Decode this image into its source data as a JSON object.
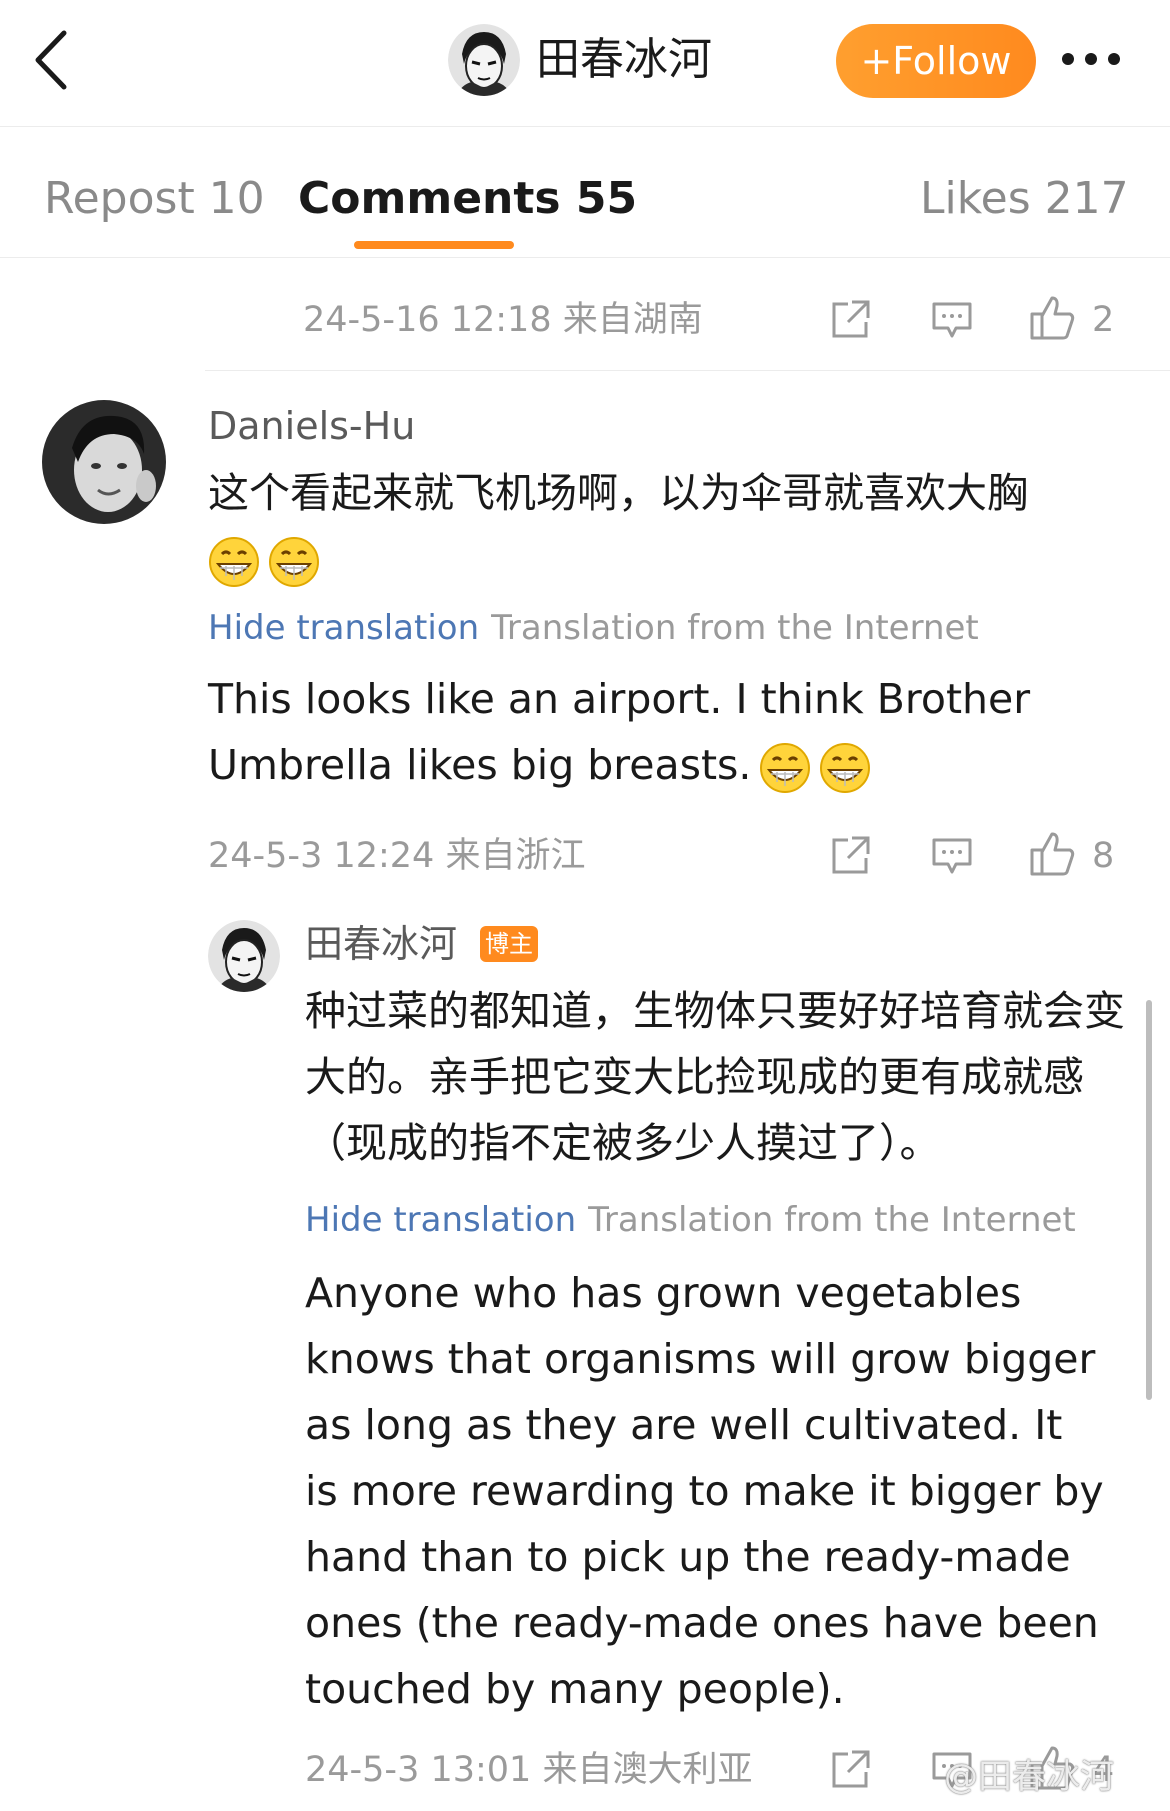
{
  "header": {
    "title": "田春冰河",
    "follow_label": "+Follow"
  },
  "tabs": {
    "repost": "Repost 10",
    "comments": "Comments 55",
    "likes": "Likes 217"
  },
  "prev_comment": {
    "meta": "24-5-16 12:18  来自湖南",
    "likes": "2"
  },
  "comments": [
    {
      "username": "Daniels-Hu",
      "text": "这个看起来就飞机场啊，以为伞哥就喜欢大胸",
      "hide_translation": "Hide translation",
      "translation_source": "Translation from the Internet",
      "translation": "This looks like an airport. I think Brother Umbrella likes big breasts.",
      "meta": "24-5-3 12:24  来自浙江",
      "likes": "8"
    },
    {
      "username": "田春冰河",
      "badge": "博主",
      "text": "种过菜的都知道，生物体只要好好培育就会变大的。亲手把它变大比捡现成的更有成就感（现成的指不定被多少人摸过了）。",
      "hide_translation": "Hide translation",
      "translation_source": "Translation from the Internet",
      "translation": "Anyone who has grown vegetables knows that organisms will grow bigger as long as they are well cultivated. It is more rewarding to make it bigger by hand than to pick up the ready-made ones (the ready-made ones have been touched by many people).",
      "meta": "24-5-3 13:01  来自澳大利亚",
      "likes": "4"
    }
  ],
  "watermark": "@田春冰河",
  "colors": {
    "accent": "#ff8a1e",
    "link": "#4d77b4",
    "muted": "#9a9a9a"
  },
  "icons": [
    "back-icon",
    "more-icon",
    "share-icon",
    "reply-icon",
    "like-icon",
    "grin-emoji"
  ]
}
